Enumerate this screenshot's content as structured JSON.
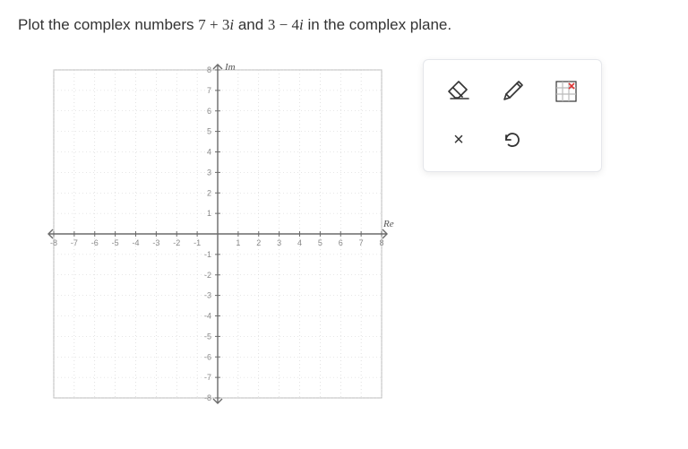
{
  "prompt": {
    "pre": "Plot the complex numbers ",
    "expr1": "7 + 3",
    "i1": "i",
    "mid": " and ",
    "expr2": "3 − 4",
    "i2": "i",
    "post": " in the complex plane."
  },
  "chart_data": {
    "type": "scatter",
    "title": "",
    "xlabel": "Re",
    "ylabel": "Im",
    "xlim": [
      -8,
      8
    ],
    "ylim": [
      -8,
      8
    ],
    "xticks": [
      -8,
      -7,
      -6,
      -5,
      -4,
      -3,
      -2,
      -1,
      1,
      2,
      3,
      4,
      5,
      6,
      7,
      8
    ],
    "yticks": [
      -8,
      -7,
      -6,
      -5,
      -4,
      -3,
      -2,
      -1,
      1,
      2,
      3,
      4,
      5,
      6,
      7,
      8
    ],
    "series": [],
    "grid": true
  },
  "toolbar": {
    "eraser_label": "Eraser",
    "pencil_label": "Pencil",
    "point_label": "Point",
    "close_label": "×",
    "undo_label": "↺"
  }
}
